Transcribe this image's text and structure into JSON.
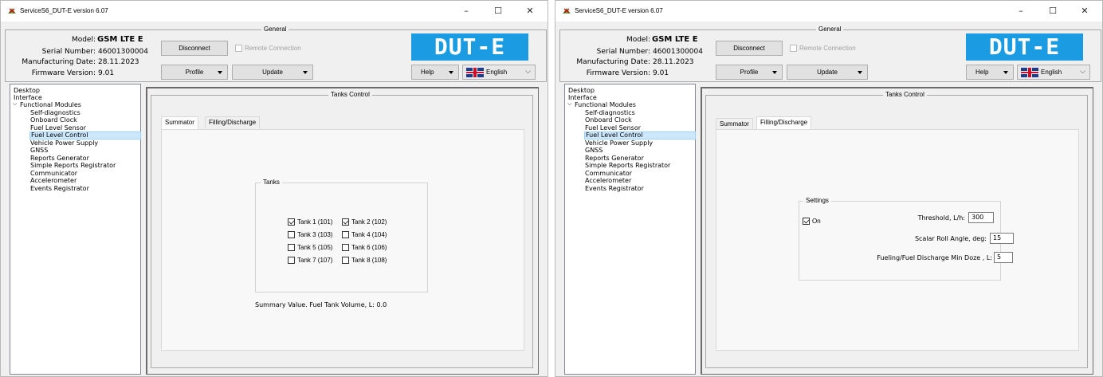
{
  "window_title": "ServiceS6_DUT-E version 6.07",
  "window_controls": {
    "minimize": "–",
    "maximize": "☐",
    "close": "✕"
  },
  "general": {
    "legend": "General",
    "model_label": "Model:",
    "model_value": "GSM LTE E",
    "serial_label": "Serial Number:",
    "serial_value": "46001300004",
    "mfg_label": "Manufacturing Date:",
    "mfg_value": "28.11.2023",
    "fw_label": "Firmware Version:",
    "fw_value": "9.01",
    "disconnect": "Disconnect",
    "remote_connection": "Remote Connection",
    "profile": "Profile",
    "update": "Update",
    "help": "Help",
    "language": "English",
    "logo": "DUT-E",
    "logo_color": "#1b9ce2"
  },
  "tree": {
    "items": [
      "Desktop",
      "Interface",
      "Functional Modules",
      "Self-diagnostics",
      "Onboard Clock",
      "Fuel Level Sensor",
      "Fuel Level Control",
      "Vehicle Power Supply",
      "GNSS",
      "Reports Generator",
      "Simple Reports Registrator",
      "Communicator",
      "Accelerometer",
      "Events Registrator"
    ],
    "selected": "Fuel Level Control",
    "selection_color": "#cce8ff"
  },
  "tanks_control": {
    "legend": "Tanks Control",
    "tabs": [
      "Summator",
      "Filling/Discharge"
    ]
  },
  "summator": {
    "group_title": "Tanks",
    "tanks": [
      {
        "label": "Tank 1 (101)",
        "checked": true
      },
      {
        "label": "Tank 2 (102)",
        "checked": true
      },
      {
        "label": "Tank 3 (103)",
        "checked": false
      },
      {
        "label": "Tank 4 (104)",
        "checked": false
      },
      {
        "label": "Tank 5 (105)",
        "checked": false
      },
      {
        "label": "Tank 6 (106)",
        "checked": false
      },
      {
        "label": "Tank 7 (107)",
        "checked": false
      },
      {
        "label": "Tank 8 (108)",
        "checked": false
      }
    ],
    "summary_label": "Summary Value. Fuel Tank Volume, L: ",
    "summary_value": "0.0"
  },
  "filling": {
    "group_title": "Settings",
    "on_label": "On",
    "on_checked": true,
    "threshold_label": "Threshold, L/h:",
    "threshold_value": "300",
    "roll_label": "Scalar Roll Angle, deg:",
    "roll_value": "15",
    "doze_label": "Fueling/Fuel Discharge Min Doze , L:",
    "doze_value": "5"
  }
}
